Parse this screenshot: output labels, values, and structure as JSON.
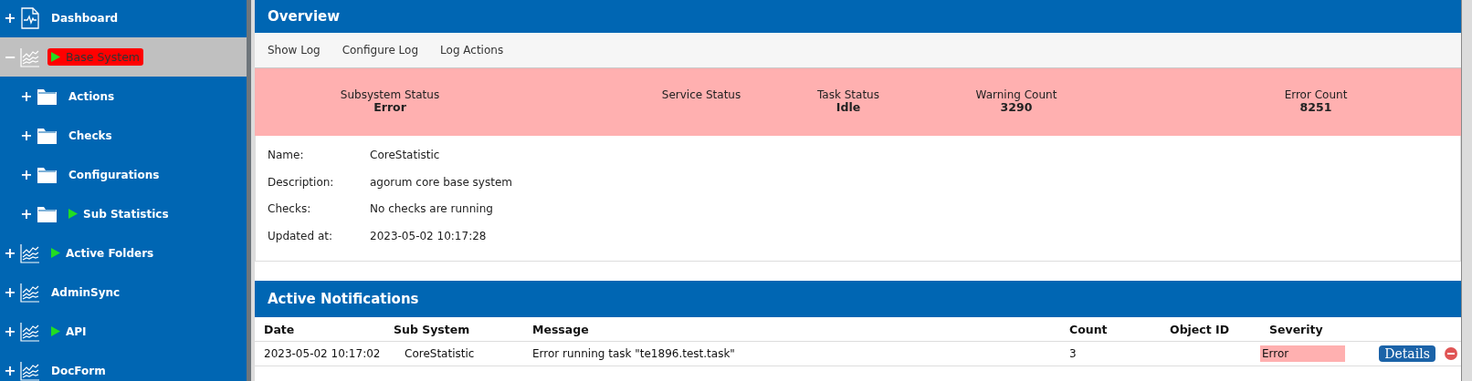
{
  "sidebar": {
    "items": [
      {
        "label": "Dashboard",
        "kind": "dashboard",
        "toggle": "+",
        "running": false,
        "alert": false,
        "selected": false
      },
      {
        "label": "Base System",
        "kind": "chart",
        "toggle": "−",
        "running": true,
        "alert": true,
        "selected": true,
        "children": [
          {
            "label": "Actions",
            "kind": "folder",
            "toggle": "+",
            "running": false,
            "alert": false,
            "selected": false
          },
          {
            "label": "Checks",
            "kind": "folder",
            "toggle": "+",
            "running": false,
            "alert": false,
            "selected": false
          },
          {
            "label": "Configurations",
            "kind": "folder",
            "toggle": "+",
            "running": false,
            "alert": false,
            "selected": false
          },
          {
            "label": "Sub Statistics",
            "kind": "folder",
            "toggle": "+",
            "running": true,
            "alert": false,
            "selected": false
          }
        ]
      },
      {
        "label": "Active Folders",
        "kind": "chart",
        "toggle": "+",
        "running": true,
        "alert": false,
        "selected": false
      },
      {
        "label": "AdminSync",
        "kind": "chart",
        "toggle": "+",
        "running": false,
        "alert": false,
        "selected": false
      },
      {
        "label": "API",
        "kind": "chart",
        "toggle": "+",
        "running": true,
        "alert": false,
        "selected": false
      },
      {
        "label": "DocForm",
        "kind": "chart",
        "toggle": "+",
        "running": false,
        "alert": false,
        "selected": false
      }
    ]
  },
  "overview": {
    "title": "Overview",
    "toolbar": [
      "Show Log",
      "Configure Log",
      "Log Actions"
    ],
    "status": [
      {
        "label": "Subsystem Status",
        "value": "Error"
      },
      {
        "label": "Service Status"
      },
      {
        "label": "Task Status",
        "value": "Idle"
      },
      {
        "label": "Warning Count",
        "value": "3290"
      },
      {
        "label": "Error Count",
        "value": "8251"
      }
    ],
    "details": [
      {
        "label": "Name:",
        "value": "CoreStatistic"
      },
      {
        "label": "Description:",
        "value": "agorum core base system"
      },
      {
        "label": "Checks:",
        "value": "No checks are running"
      },
      {
        "label": "Updated at:",
        "value": "2023-05-02 10:17:28"
      }
    ]
  },
  "notifications": {
    "title": "Active Notifications",
    "columns": [
      "Date",
      "Sub System",
      "Message",
      "Count",
      "Object ID",
      "Severity"
    ],
    "rows": [
      {
        "date": "2023-05-02 10:17:02",
        "sub_system": "CoreStatistic",
        "message": "Error running task \"te1896.test.task\"",
        "count": "3",
        "severity": "Error",
        "action": "Details"
      }
    ]
  }
}
